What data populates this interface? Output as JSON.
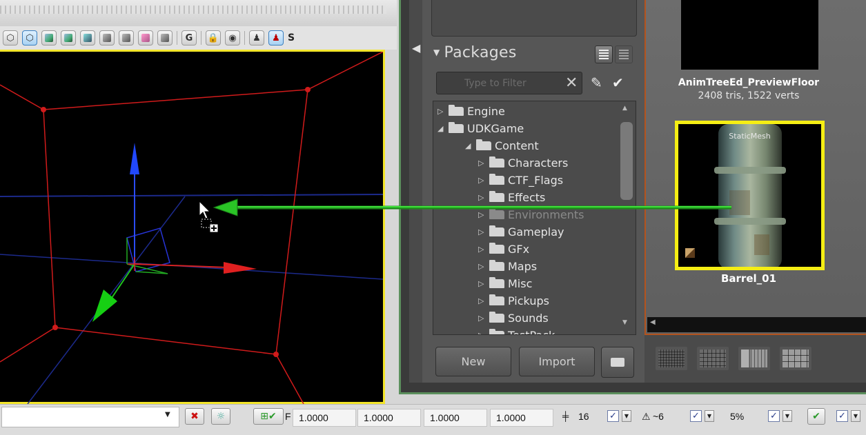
{
  "viewport": {
    "toolbar_g_label": "G",
    "toolbar_trailing_label": "S"
  },
  "packages": {
    "title": "Packages",
    "filter_placeholder": "Type to Filter",
    "tree": [
      {
        "label": "Engine",
        "expander": "▷"
      },
      {
        "label": "UDKGame",
        "expander": "◢"
      },
      {
        "label": "Content",
        "expander": "◢"
      },
      {
        "label": "Characters",
        "expander": "▷"
      },
      {
        "label": "CTF_Flags",
        "expander": "▷"
      },
      {
        "label": "Effects",
        "expander": "▷"
      },
      {
        "label": "Environments",
        "expander": "▷"
      },
      {
        "label": "Gameplay",
        "expander": "▷"
      },
      {
        "label": "GFx",
        "expander": "▷"
      },
      {
        "label": "Maps",
        "expander": "▷"
      },
      {
        "label": "Misc",
        "expander": "▷"
      },
      {
        "label": "Pickups",
        "expander": "▷"
      },
      {
        "label": "Sounds",
        "expander": "▷"
      },
      {
        "label": "TestPack",
        "expander": "▷"
      }
    ],
    "new_label": "New",
    "import_label": "Import"
  },
  "assets": {
    "floor": {
      "name": "AnimTreeEd_PreviewFloor",
      "stats": "2408 tris, 1522 verts"
    },
    "barrel": {
      "type": "StaticMesh",
      "name": "Barrel_01"
    }
  },
  "status_bar": {
    "combo_value": "",
    "scale_prefix": "F",
    "drawscale": "1.0000",
    "scale_x": "1.0000",
    "scale_y": "1.0000",
    "scale_z": "1.0000",
    "grid_value": "16",
    "rotation_value": "~6",
    "scaling_value": "5%",
    "check_mark": "✓"
  },
  "colors": {
    "viewport_border": "#f3e52a",
    "selection_border": "#f5ee14",
    "drag_arrow": "#22c21d",
    "browser_frame": "#5b8f5c",
    "asset_area_border": "#b4531d"
  }
}
